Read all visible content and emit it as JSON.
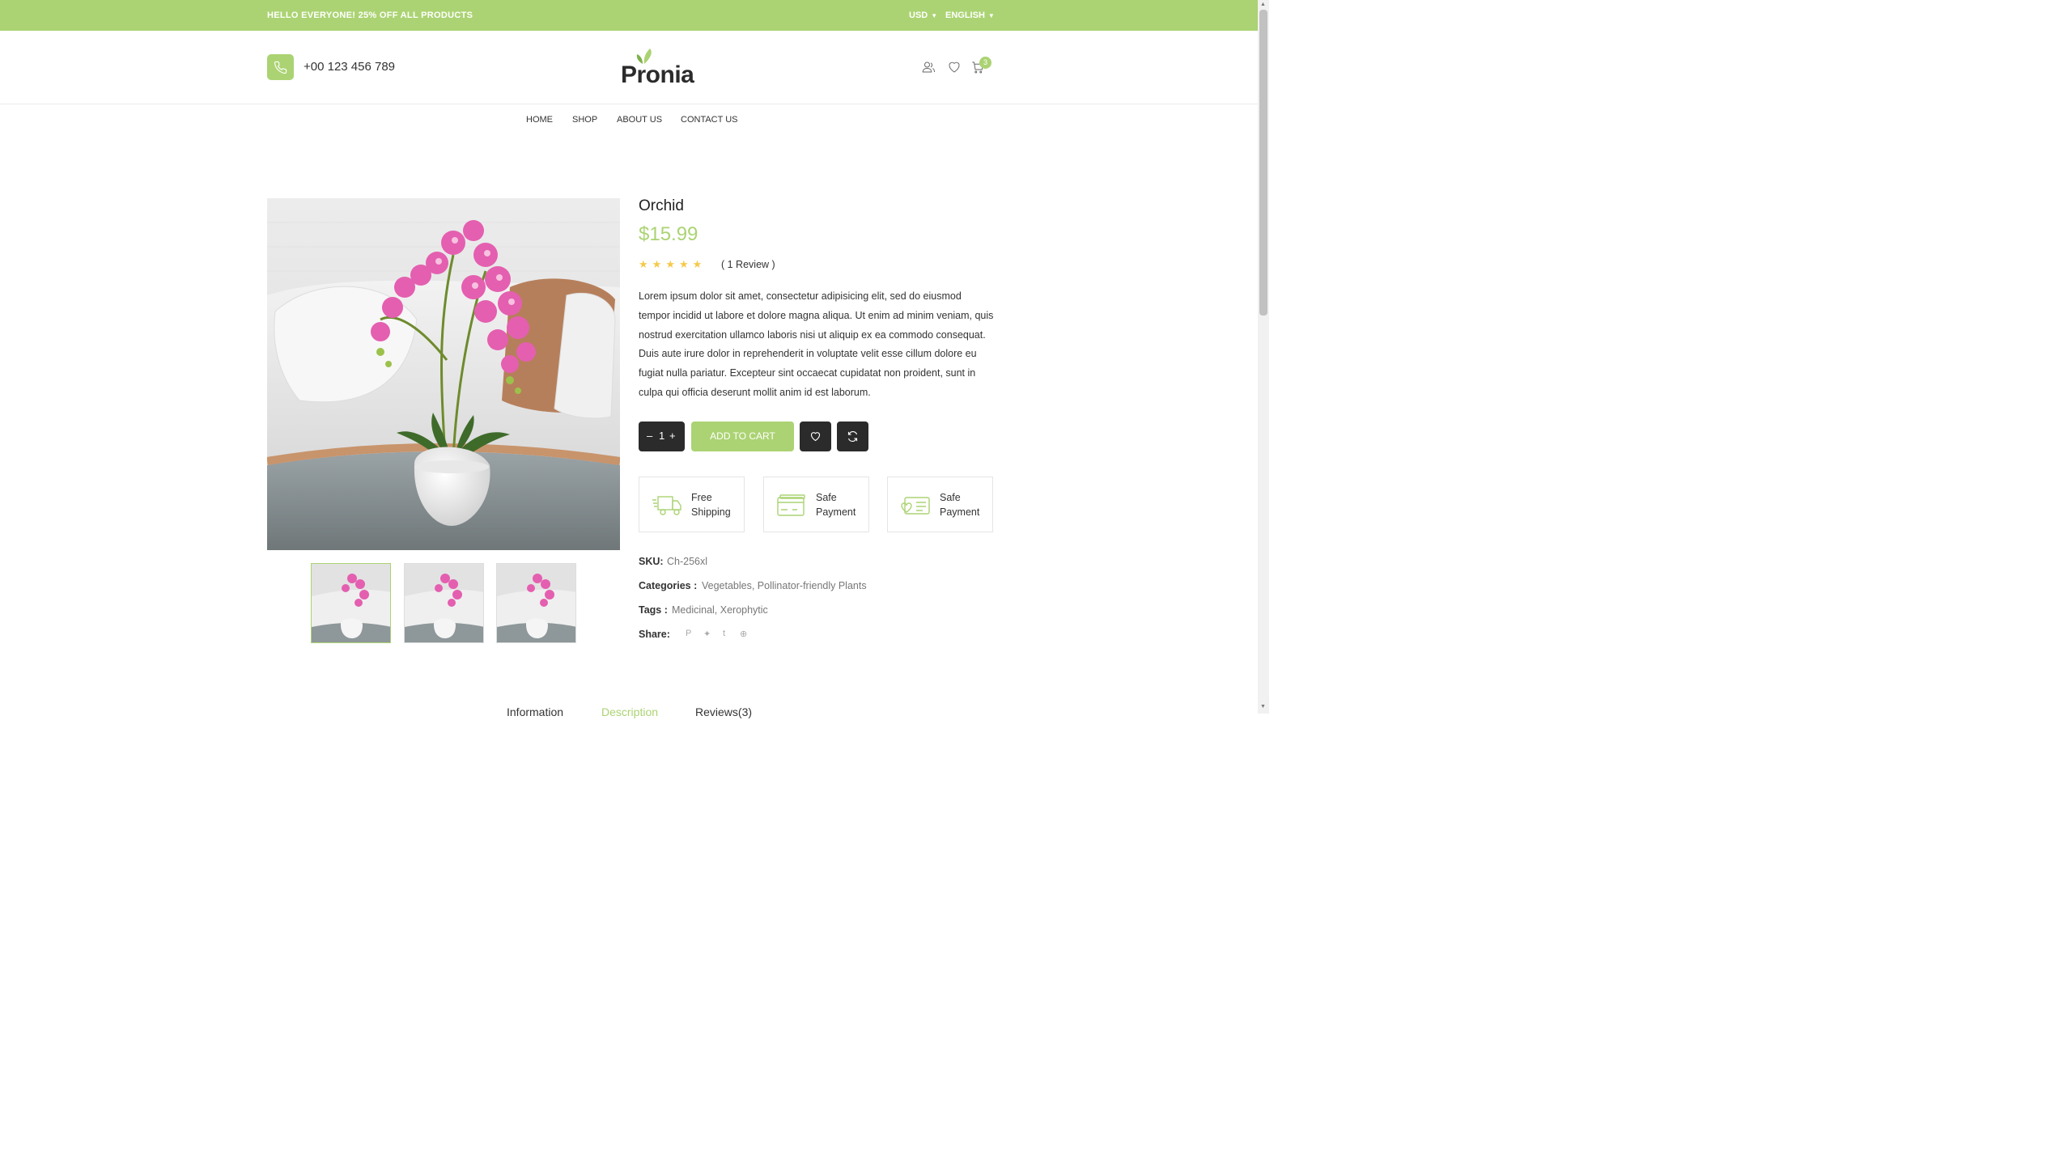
{
  "topbar": {
    "promo": "HELLO EVERYONE! 25% OFF ALL PRODUCTS",
    "currency": "USD",
    "language": "ENGLISH"
  },
  "header": {
    "phone": "+00 123 456 789",
    "logo": "Pronia",
    "cart_count": "3",
    "icons": [
      "phone-icon",
      "user-icon",
      "heart-icon",
      "cart-icon"
    ]
  },
  "nav": [
    "HOME",
    "SHOP",
    "ABOUT US",
    "CONTACT US"
  ],
  "product": {
    "title": "Orchid",
    "price": "$15.99",
    "rating": 5,
    "reviews": "( 1 Review )",
    "description": "Lorem ipsum dolor sit amet, consectetur adipisicing elit, sed do eiusmod tempor incidid ut labore et dolore magna aliqua. Ut enim ad minim veniam, quis nostrud exercitation ullamco laboris nisi ut aliquip ex ea commodo consequat. Duis aute irure dolor in reprehenderit in voluptate velit esse cillum dolore eu fugiat nulla pariatur. Excepteur sint occaecat cupidatat non proident, sunt in culpa qui officia deserunt mollit anim id est laborum.",
    "quantity": "1",
    "add_to_cart": "ADD TO CART"
  },
  "features": [
    {
      "label": "Free Shipping",
      "icon": "truck-icon"
    },
    {
      "label": "Safe Payment",
      "icon": "card-icon"
    },
    {
      "label": "Safe Payment",
      "icon": "wallet-icon"
    }
  ],
  "meta": {
    "sku_label": "SKU:",
    "sku": "Ch-256xl",
    "categories_label": "Categories :",
    "categories": "Vegetables, Pollinator-friendly Plants",
    "tags_label": "Tags :",
    "tags": "Medicinal, Xerophytic",
    "share_label": "Share:",
    "share_icons": [
      "pinterest-icon",
      "twitter-icon",
      "tumblr-icon",
      "dribbble-icon"
    ]
  },
  "tabs": [
    "Information",
    "Description",
    "Reviews(3)"
  ],
  "colors": {
    "accent": "#abd373",
    "dark": "#2b2b2b",
    "star": "#f5c94a"
  }
}
